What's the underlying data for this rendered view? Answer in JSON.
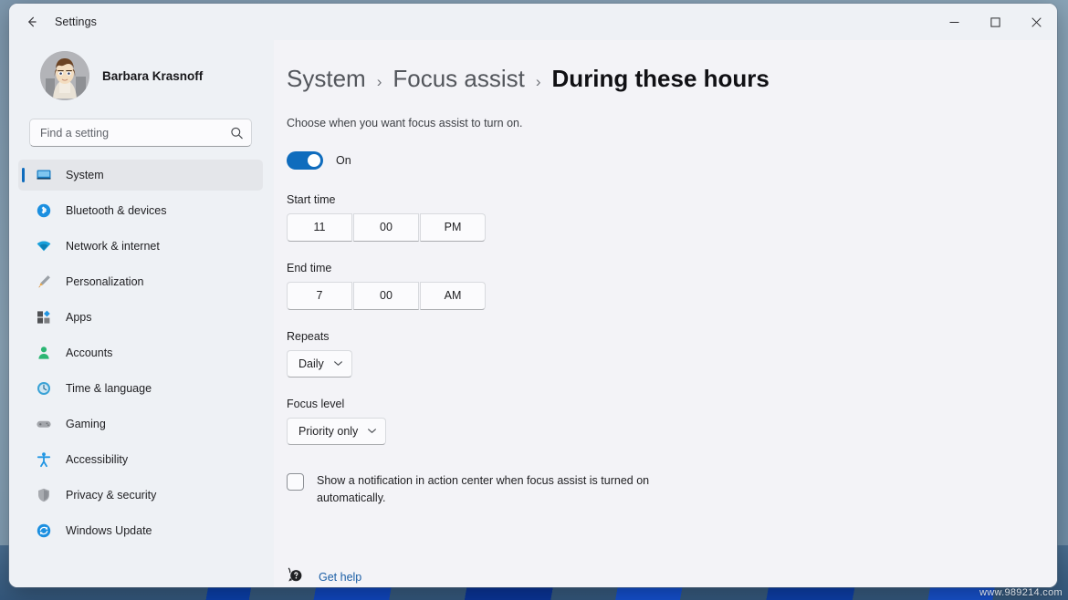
{
  "window": {
    "titlebar_title": "Settings",
    "back_icon": "arrow-left-icon",
    "minimize_label": "─",
    "maximize_label": "□",
    "close_label": "✕"
  },
  "account": {
    "name": "Barbara Krasnoff",
    "avatar_name": "user-avatar"
  },
  "search": {
    "placeholder": "Find a setting",
    "value": "",
    "icon": "search-icon"
  },
  "sidebar": {
    "items": [
      {
        "label": "System",
        "icon": "monitor-icon",
        "selected": true
      },
      {
        "label": "Bluetooth & devices",
        "icon": "bluetooth-icon",
        "selected": false
      },
      {
        "label": "Network & internet",
        "icon": "wifi-icon",
        "selected": false
      },
      {
        "label": "Personalization",
        "icon": "paintbrush-icon",
        "selected": false
      },
      {
        "label": "Apps",
        "icon": "apps-grid-icon",
        "selected": false
      },
      {
        "label": "Accounts",
        "icon": "person-icon",
        "selected": false
      },
      {
        "label": "Time & language",
        "icon": "clock-icon",
        "selected": false
      },
      {
        "label": "Gaming",
        "icon": "gamepad-icon",
        "selected": false
      },
      {
        "label": "Accessibility",
        "icon": "accessibility-icon",
        "selected": false
      },
      {
        "label": "Privacy & security",
        "icon": "shield-icon",
        "selected": false
      },
      {
        "label": "Windows Update",
        "icon": "update-arrows-icon",
        "selected": false
      }
    ]
  },
  "breadcrumb": {
    "crumb1": "System",
    "sep1": "›",
    "crumb2": "Focus assist",
    "sep2": "›",
    "current": "During these hours"
  },
  "main": {
    "subtitle": "Choose when you want focus assist to turn on.",
    "toggle": {
      "state_label": "On",
      "checked": true,
      "accent_color": "#0f6cbd"
    },
    "start_time": {
      "label": "Start time",
      "hour": "11",
      "minute": "00",
      "meridiem": "PM"
    },
    "end_time": {
      "label": "End time",
      "hour": "7",
      "minute": "00",
      "meridiem": "AM"
    },
    "repeats": {
      "label": "Repeats",
      "value": "Daily",
      "chevron": "chevron-down-icon"
    },
    "focus_level": {
      "label": "Focus level",
      "value": "Priority only",
      "chevron": "chevron-down-icon"
    },
    "notification_checkbox": {
      "label": "Show a notification in action center when focus assist is turned on automatically.",
      "checked": false
    },
    "get_help": {
      "label": "Get help",
      "icon": "help-question-icon",
      "link_color": "#1c5fa6"
    }
  },
  "watermark": {
    "text": "www.989214.com"
  }
}
